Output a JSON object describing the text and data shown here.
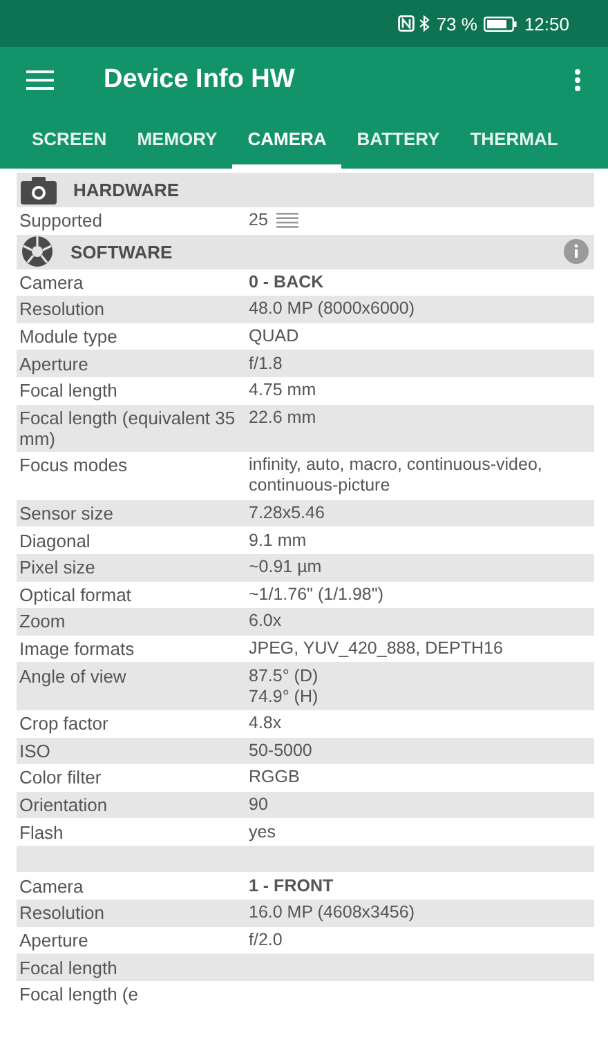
{
  "status_bar": {
    "battery_text": "73 %",
    "time": "12:50"
  },
  "app_bar": {
    "title": "Device Info HW"
  },
  "tabs": [
    {
      "label": "SCREEN",
      "selected": false
    },
    {
      "label": "MEMORY",
      "selected": false
    },
    {
      "label": "CAMERA",
      "selected": true
    },
    {
      "label": "BATTERY",
      "selected": false
    },
    {
      "label": "THERMAL",
      "selected": false
    }
  ],
  "items": [
    {
      "kind": "header",
      "title": "HARDWARE"
    },
    {
      "kind": "row",
      "label": "Supported",
      "value": "25",
      "list": true
    },
    {
      "kind": "header",
      "title": "SOFTWARE",
      "info": true
    },
    {
      "kind": "row",
      "label": "Camera",
      "value": "0 - BACK",
      "bold": true
    },
    {
      "kind": "row",
      "label": "Resolution",
      "value": "48.0 MP (8000x6000)"
    },
    {
      "kind": "row",
      "label": "Module type",
      "value": "QUAD"
    },
    {
      "kind": "row",
      "label": "Aperture",
      "value": "f/1.8"
    },
    {
      "kind": "row",
      "label": "Focal length",
      "value": "4.75 mm"
    },
    {
      "kind": "row",
      "label": "Focal length (equivalent 35 mm)",
      "value": "22.6 mm"
    },
    {
      "kind": "row",
      "label": "Focus modes",
      "value": "infinity, auto, macro, continuous-video, continuous-picture"
    },
    {
      "kind": "row",
      "label": "Sensor size",
      "value": "7.28x5.46"
    },
    {
      "kind": "row",
      "label": "Diagonal",
      "value": "9.1 mm"
    },
    {
      "kind": "row",
      "label": "Pixel size",
      "value": "~0.91 µm"
    },
    {
      "kind": "row",
      "label": "Optical format",
      "value": "~1/1.76\" (1/1.98\")"
    },
    {
      "kind": "row",
      "label": "Zoom",
      "value": "6.0x"
    },
    {
      "kind": "row",
      "label": "Image formats",
      "value": "JPEG, YUV_420_888, DEPTH16"
    },
    {
      "kind": "row",
      "label": "Angle of view",
      "value": "87.5° (D)\n74.9° (H)"
    },
    {
      "kind": "row",
      "label": "Crop factor",
      "value": "4.8x"
    },
    {
      "kind": "row",
      "label": "ISO",
      "value": "50-5000"
    },
    {
      "kind": "row",
      "label": "Color filter",
      "value": "RGGB"
    },
    {
      "kind": "row",
      "label": "Orientation",
      "value": "90"
    },
    {
      "kind": "row",
      "label": "Flash",
      "value": "yes"
    },
    {
      "kind": "blank"
    },
    {
      "kind": "row",
      "label": "Camera",
      "value": "1 - FRONT",
      "bold": true
    },
    {
      "kind": "row",
      "label": "Resolution",
      "value": "16.0 MP (4608x3456)"
    },
    {
      "kind": "row",
      "label": "Aperture",
      "value": "f/2.0"
    },
    {
      "kind": "row",
      "label": "Focal length"
    },
    {
      "kind": "row",
      "label": "Focal length (e"
    }
  ]
}
